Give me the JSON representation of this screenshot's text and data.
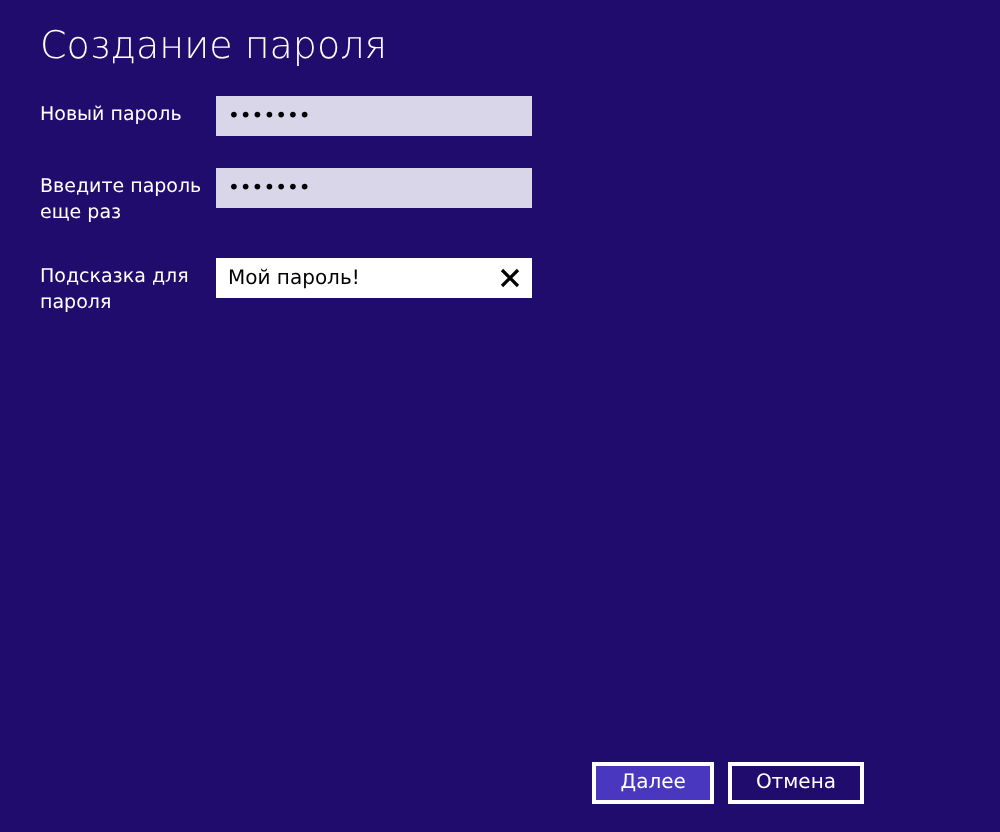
{
  "title": "Создание пароля",
  "fields": [
    {
      "label": "Новый пароль",
      "kind": "password",
      "value": "•••••••"
    },
    {
      "label": "Введите пароль еще раз",
      "kind": "password",
      "value": "•••••••"
    },
    {
      "label": "Подсказка для пароля",
      "kind": "text",
      "value": "Мой пароль!"
    }
  ],
  "buttons": [
    {
      "label": "Далее",
      "kind": "primary"
    },
    {
      "label": "Отмена",
      "kind": "secondary"
    }
  ]
}
